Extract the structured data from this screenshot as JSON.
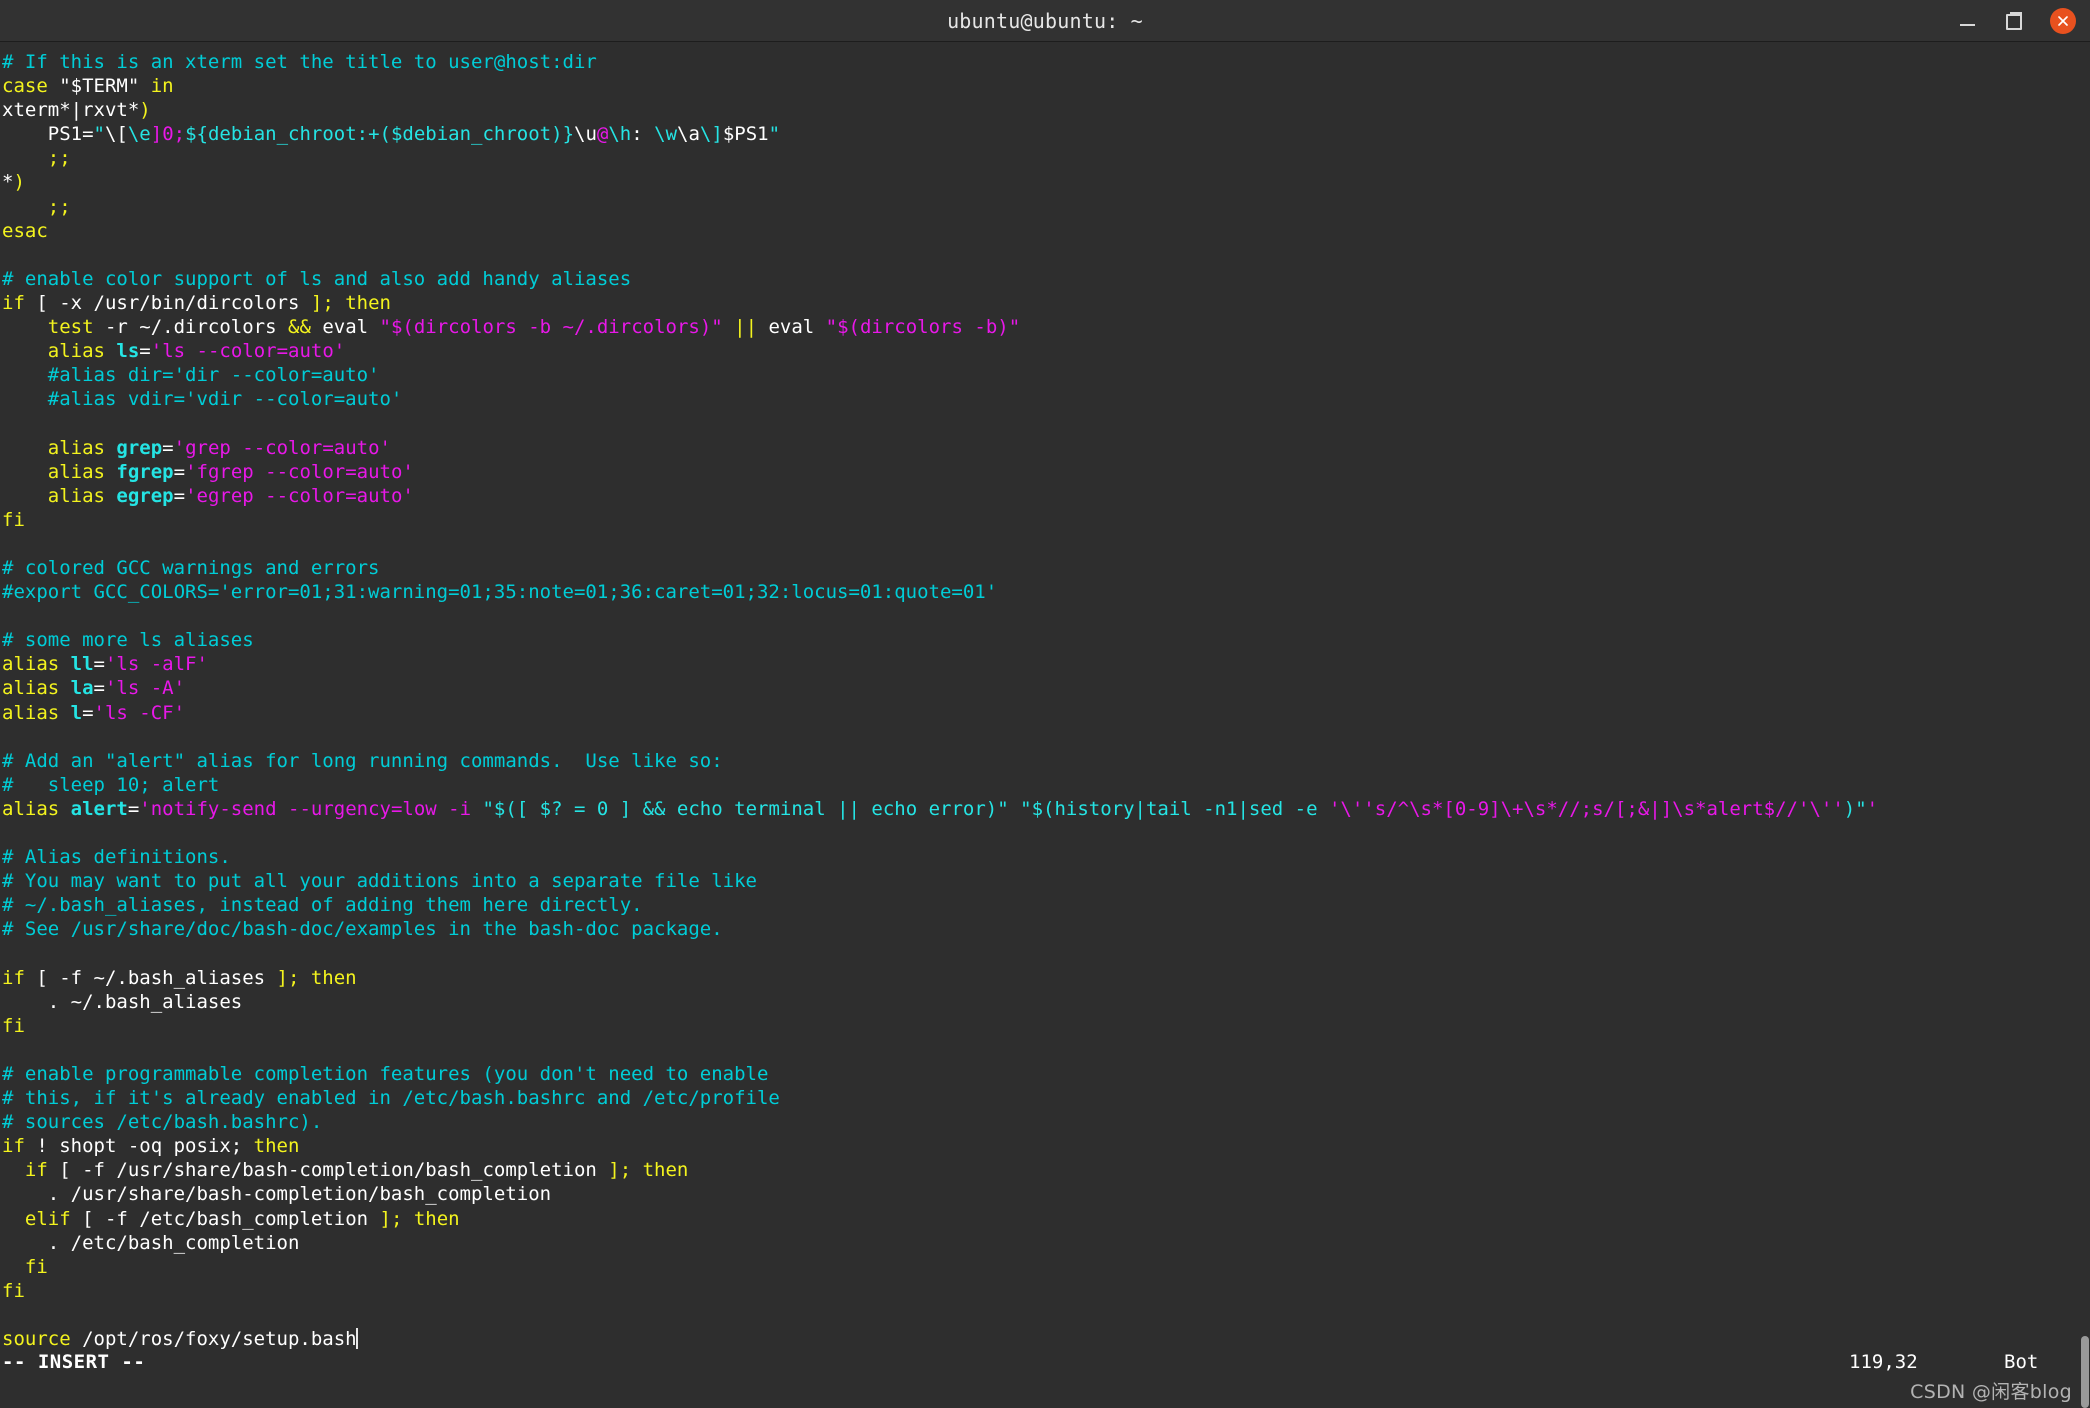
{
  "window": {
    "title": "ubuntu@ubuntu: ~",
    "controls": {
      "minimize": "minimize",
      "maximize": "maximize",
      "close": "close"
    },
    "accent_close_color": "#e8511f",
    "background_color": "#2e2e2e",
    "titlebar_color": "#323232"
  },
  "editor": {
    "filetype": "bashrc",
    "mode_label": "-- INSERT --",
    "cursor_position": "119,32",
    "scroll_location": "Bot",
    "colors": {
      "comment": "#00cdd7",
      "keyword": "#f3f31e",
      "string": "#e818e8",
      "identifier": "#25e4e4",
      "plain": "#ffffff"
    },
    "lines": [
      {
        "id": 1,
        "tokens": [
          {
            "t": "# If this is an xterm set the title to user@host:dir",
            "c": "cmt"
          }
        ]
      },
      {
        "id": 2,
        "tokens": [
          {
            "t": "case ",
            "c": "kw"
          },
          {
            "t": "\"$TERM\"",
            "c": "pln"
          },
          {
            "t": " in",
            "c": "kw"
          }
        ]
      },
      {
        "id": 3,
        "tokens": [
          {
            "t": "xterm*|rxvt*",
            "c": "pln"
          },
          {
            "t": ")",
            "c": "kw"
          }
        ]
      },
      {
        "id": 4,
        "tokens": [
          {
            "t": "    PS1=",
            "c": "pln"
          },
          {
            "t": "\"",
            "c": "cy"
          },
          {
            "t": "\\[",
            "c": "pln"
          },
          {
            "t": "\\e",
            "c": "cy"
          },
          {
            "t": "]0;",
            "c": "str"
          },
          {
            "t": "${debian_chroot:+($debian_chroot)}",
            "c": "cy"
          },
          {
            "t": "\\u",
            "c": "pln"
          },
          {
            "t": "@",
            "c": "str"
          },
          {
            "t": "\\h",
            "c": "cy"
          },
          {
            "t": ": ",
            "c": "pln"
          },
          {
            "t": "\\w",
            "c": "cy"
          },
          {
            "t": "\\a",
            "c": "pln"
          },
          {
            "t": "\\]",
            "c": "cy"
          },
          {
            "t": "$PS1",
            "c": "pln"
          },
          {
            "t": "\"",
            "c": "cy"
          }
        ]
      },
      {
        "id": 5,
        "tokens": [
          {
            "t": "    ;;",
            "c": "kw"
          }
        ]
      },
      {
        "id": 6,
        "tokens": [
          {
            "t": "*",
            "c": "pln"
          },
          {
            "t": ")",
            "c": "kw"
          }
        ]
      },
      {
        "id": 7,
        "tokens": [
          {
            "t": "    ;;",
            "c": "kw"
          }
        ]
      },
      {
        "id": 8,
        "tokens": [
          {
            "t": "esac",
            "c": "kw"
          }
        ]
      },
      {
        "id": 9,
        "tokens": [
          {
            "t": "",
            "c": "pln"
          }
        ]
      },
      {
        "id": 10,
        "tokens": [
          {
            "t": "# enable color support of ls and also add handy aliases",
            "c": "cmt"
          }
        ]
      },
      {
        "id": 11,
        "tokens": [
          {
            "t": "if ",
            "c": "kw"
          },
          {
            "t": "[ -x /usr/bin/dircolors ",
            "c": "pln"
          },
          {
            "t": "]; then",
            "c": "kw"
          }
        ]
      },
      {
        "id": 12,
        "tokens": [
          {
            "t": "    ",
            "c": "pln"
          },
          {
            "t": "test",
            "c": "kw"
          },
          {
            "t": " -r ~/.dircolors ",
            "c": "pln"
          },
          {
            "t": "&&",
            "c": "kw"
          },
          {
            "t": " eval ",
            "c": "pln"
          },
          {
            "t": "\"$(dircolors -b ~/.dircolors)\"",
            "c": "str"
          },
          {
            "t": " || ",
            "c": "kw"
          },
          {
            "t": "eval ",
            "c": "pln"
          },
          {
            "t": "\"$(dircolors -b)\"",
            "c": "str"
          }
        ]
      },
      {
        "id": 13,
        "tokens": [
          {
            "t": "    ",
            "c": "pln"
          },
          {
            "t": "alias ",
            "c": "kw"
          },
          {
            "t": "ls",
            "c": "ident"
          },
          {
            "t": "=",
            "c": "pln"
          },
          {
            "t": "'ls --color=auto'",
            "c": "str"
          }
        ]
      },
      {
        "id": 14,
        "tokens": [
          {
            "t": "    #alias dir='dir --color=auto'",
            "c": "cmt"
          }
        ]
      },
      {
        "id": 15,
        "tokens": [
          {
            "t": "    #alias vdir='vdir --color=auto'",
            "c": "cmt"
          }
        ]
      },
      {
        "id": 16,
        "tokens": [
          {
            "t": "",
            "c": "pln"
          }
        ]
      },
      {
        "id": 17,
        "tokens": [
          {
            "t": "    ",
            "c": "pln"
          },
          {
            "t": "alias ",
            "c": "kw"
          },
          {
            "t": "grep",
            "c": "ident"
          },
          {
            "t": "=",
            "c": "pln"
          },
          {
            "t": "'grep --color=auto'",
            "c": "str"
          }
        ]
      },
      {
        "id": 18,
        "tokens": [
          {
            "t": "    ",
            "c": "pln"
          },
          {
            "t": "alias ",
            "c": "kw"
          },
          {
            "t": "fgrep",
            "c": "ident"
          },
          {
            "t": "=",
            "c": "pln"
          },
          {
            "t": "'fgrep --color=auto'",
            "c": "str"
          }
        ]
      },
      {
        "id": 19,
        "tokens": [
          {
            "t": "    ",
            "c": "pln"
          },
          {
            "t": "alias ",
            "c": "kw"
          },
          {
            "t": "egrep",
            "c": "ident"
          },
          {
            "t": "=",
            "c": "pln"
          },
          {
            "t": "'egrep --color=auto'",
            "c": "str"
          }
        ]
      },
      {
        "id": 20,
        "tokens": [
          {
            "t": "fi",
            "c": "kw"
          }
        ]
      },
      {
        "id": 21,
        "tokens": [
          {
            "t": "",
            "c": "pln"
          }
        ]
      },
      {
        "id": 22,
        "tokens": [
          {
            "t": "# colored GCC warnings and errors",
            "c": "cmt"
          }
        ]
      },
      {
        "id": 23,
        "tokens": [
          {
            "t": "#export GCC_COLORS='error=01;31:warning=01;35:note=01;36:caret=01;32:locus=01:quote=01'",
            "c": "cmt"
          }
        ]
      },
      {
        "id": 24,
        "tokens": [
          {
            "t": "",
            "c": "pln"
          }
        ]
      },
      {
        "id": 25,
        "tokens": [
          {
            "t": "# some more ls aliases",
            "c": "cmt"
          }
        ]
      },
      {
        "id": 26,
        "tokens": [
          {
            "t": "alias ",
            "c": "kw"
          },
          {
            "t": "ll",
            "c": "ident"
          },
          {
            "t": "=",
            "c": "pln"
          },
          {
            "t": "'ls -alF'",
            "c": "str"
          }
        ]
      },
      {
        "id": 27,
        "tokens": [
          {
            "t": "alias ",
            "c": "kw"
          },
          {
            "t": "la",
            "c": "ident"
          },
          {
            "t": "=",
            "c": "pln"
          },
          {
            "t": "'ls -A'",
            "c": "str"
          }
        ]
      },
      {
        "id": 28,
        "tokens": [
          {
            "t": "alias ",
            "c": "kw"
          },
          {
            "t": "l",
            "c": "ident"
          },
          {
            "t": "=",
            "c": "pln"
          },
          {
            "t": "'ls -CF'",
            "c": "str"
          }
        ]
      },
      {
        "id": 29,
        "tokens": [
          {
            "t": "",
            "c": "pln"
          }
        ]
      },
      {
        "id": 30,
        "tokens": [
          {
            "t": "# Add an \"alert\" alias for long running commands.  Use like so:",
            "c": "cmt"
          }
        ]
      },
      {
        "id": 31,
        "tokens": [
          {
            "t": "#   sleep 10; alert",
            "c": "cmt"
          }
        ]
      },
      {
        "id": 32,
        "tokens": [
          {
            "t": "alias ",
            "c": "kw"
          },
          {
            "t": "alert",
            "c": "ident"
          },
          {
            "t": "=",
            "c": "pln"
          },
          {
            "t": "'notify-send --urgency=low -i ",
            "c": "str"
          },
          {
            "t": "\"$([ $? = 0 ] && echo terminal || echo error)\"",
            "c": "cy"
          },
          {
            "t": " ",
            "c": "str"
          },
          {
            "t": "\"$(history|tail -n1|sed -e ",
            "c": "cy"
          },
          {
            "t": "'\\''",
            "c": "str"
          },
          {
            "t": "s/^\\s*[0-9]\\+\\s*//;s/[;&|]\\s*alert$//",
            "c": "str"
          },
          {
            "t": "'\\''",
            "c": "str"
          },
          {
            "t": ")\"",
            "c": "cy"
          },
          {
            "t": "'",
            "c": "str"
          }
        ]
      },
      {
        "id": 33,
        "tokens": [
          {
            "t": "",
            "c": "pln"
          }
        ]
      },
      {
        "id": 34,
        "tokens": [
          {
            "t": "# Alias definitions.",
            "c": "cmt"
          }
        ]
      },
      {
        "id": 35,
        "tokens": [
          {
            "t": "# You may want to put all your additions into a separate file like",
            "c": "cmt"
          }
        ]
      },
      {
        "id": 36,
        "tokens": [
          {
            "t": "# ~/.bash_aliases, instead of adding them here directly.",
            "c": "cmt"
          }
        ]
      },
      {
        "id": 37,
        "tokens": [
          {
            "t": "# See /usr/share/doc/bash-doc/examples in the bash-doc package.",
            "c": "cmt"
          }
        ]
      },
      {
        "id": 38,
        "tokens": [
          {
            "t": "",
            "c": "pln"
          }
        ]
      },
      {
        "id": 39,
        "tokens": [
          {
            "t": "if ",
            "c": "kw"
          },
          {
            "t": "[ -f ~/.bash_aliases ",
            "c": "pln"
          },
          {
            "t": "]; then",
            "c": "kw"
          }
        ]
      },
      {
        "id": 40,
        "tokens": [
          {
            "t": "    . ~/.bash_aliases",
            "c": "pln"
          }
        ]
      },
      {
        "id": 41,
        "tokens": [
          {
            "t": "fi",
            "c": "kw"
          }
        ]
      },
      {
        "id": 42,
        "tokens": [
          {
            "t": "",
            "c": "pln"
          }
        ]
      },
      {
        "id": 43,
        "tokens": [
          {
            "t": "# enable programmable completion features (you don't need to enable",
            "c": "cmt"
          }
        ]
      },
      {
        "id": 44,
        "tokens": [
          {
            "t": "# this, if it's already enabled in /etc/bash.bashrc and /etc/profile",
            "c": "cmt"
          }
        ]
      },
      {
        "id": 45,
        "tokens": [
          {
            "t": "# sources /etc/bash.bashrc).",
            "c": "cmt"
          }
        ]
      },
      {
        "id": 46,
        "tokens": [
          {
            "t": "if ",
            "c": "kw"
          },
          {
            "t": "! shopt -oq posix; ",
            "c": "pln"
          },
          {
            "t": "then",
            "c": "kw"
          }
        ]
      },
      {
        "id": 47,
        "tokens": [
          {
            "t": "  ",
            "c": "pln"
          },
          {
            "t": "if ",
            "c": "kw"
          },
          {
            "t": "[ -f /usr/share/bash-completion/bash_completion ",
            "c": "pln"
          },
          {
            "t": "]; then",
            "c": "kw"
          }
        ]
      },
      {
        "id": 48,
        "tokens": [
          {
            "t": "    . /usr/share/bash-completion/bash_completion",
            "c": "pln"
          }
        ]
      },
      {
        "id": 49,
        "tokens": [
          {
            "t": "  ",
            "c": "pln"
          },
          {
            "t": "elif ",
            "c": "kw"
          },
          {
            "t": "[ -f /etc/bash_completion ",
            "c": "pln"
          },
          {
            "t": "]; then",
            "c": "kw"
          }
        ]
      },
      {
        "id": 50,
        "tokens": [
          {
            "t": "    . /etc/bash_completion",
            "c": "pln"
          }
        ]
      },
      {
        "id": 51,
        "tokens": [
          {
            "t": "  ",
            "c": "pln"
          },
          {
            "t": "fi",
            "c": "kw"
          }
        ]
      },
      {
        "id": 52,
        "tokens": [
          {
            "t": "fi",
            "c": "kw"
          }
        ]
      },
      {
        "id": 53,
        "tokens": [
          {
            "t": "",
            "c": "pln"
          }
        ]
      },
      {
        "id": 54,
        "tokens": [
          {
            "t": "source",
            "c": "kw"
          },
          {
            "t": " /opt/ros/foxy/setup.bash",
            "c": "pln"
          },
          {
            "t": "__CURSOR__",
            "c": "cursor"
          }
        ]
      }
    ]
  },
  "watermark": {
    "text": "CSDN @闲客blog"
  }
}
